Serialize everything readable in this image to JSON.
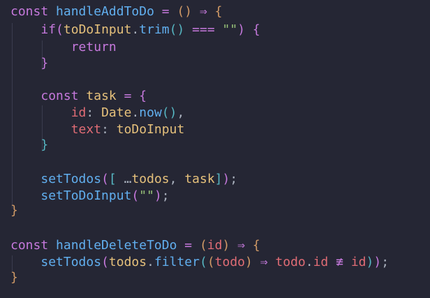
{
  "colors": {
    "background": "#252634",
    "keyword": "#c679dd",
    "function": "#61afef",
    "variable": "#e5c07b",
    "string": "#98c379",
    "property": "#e06c75",
    "punctuation": "#abb2bf"
  },
  "code": {
    "l1": {
      "kw": "const",
      "name": "handleAddToDo",
      "eq": "=",
      "parens": "()",
      "arrow": "⇒",
      "brace": "{"
    },
    "l2": {
      "kw": "if",
      "p_open": "(",
      "obj": "toDoInput",
      "dot": ".",
      "method": "trim",
      "call": "()",
      "op": "===",
      "str": "\"\"",
      "p_close": ")",
      "brace": "{"
    },
    "l3": {
      "kw": "return"
    },
    "l4": {
      "brace": "}"
    },
    "l6": {
      "kw": "const",
      "name": "task",
      "eq": "=",
      "brace": "{"
    },
    "l7": {
      "prop": "id",
      "colon": ":",
      "obj": "Date",
      "dot": ".",
      "method": "now",
      "call": "()",
      "comma": ","
    },
    "l8": {
      "prop": "text",
      "colon": ":",
      "value": "toDoInput"
    },
    "l9": {
      "brace": "}"
    },
    "l11": {
      "fn": "setTodos",
      "p_open": "(",
      "b_open": "[",
      "spread": "…",
      "arg1": "todos",
      "comma": ",",
      "arg2": "task",
      "b_close": "]",
      "p_close": ")",
      "semi": ";"
    },
    "l12": {
      "fn": "setToDoInput",
      "p_open": "(",
      "str": "\"\"",
      "p_close": ")",
      "semi": ";"
    },
    "l13": {
      "brace": "}"
    },
    "l15": {
      "kw": "const",
      "name": "handleDeleteToDo",
      "eq": "=",
      "p_open": "(",
      "param": "id",
      "p_close": ")",
      "arrow": "⇒",
      "brace": "{"
    },
    "l16": {
      "fn": "setTodos",
      "p_open": "(",
      "obj": "todos",
      "dot": ".",
      "method": "filter",
      "p_open2": "(",
      "p_open3": "(",
      "param": "todo",
      "p_close3": ")",
      "arrow": "⇒",
      "obj2": "todo",
      "dot2": ".",
      "prop": "id",
      "op": "≢",
      "arg": "id",
      "p_close2": ")",
      "p_close": ")",
      "semi": ";"
    },
    "l17": {
      "brace": "}"
    }
  }
}
